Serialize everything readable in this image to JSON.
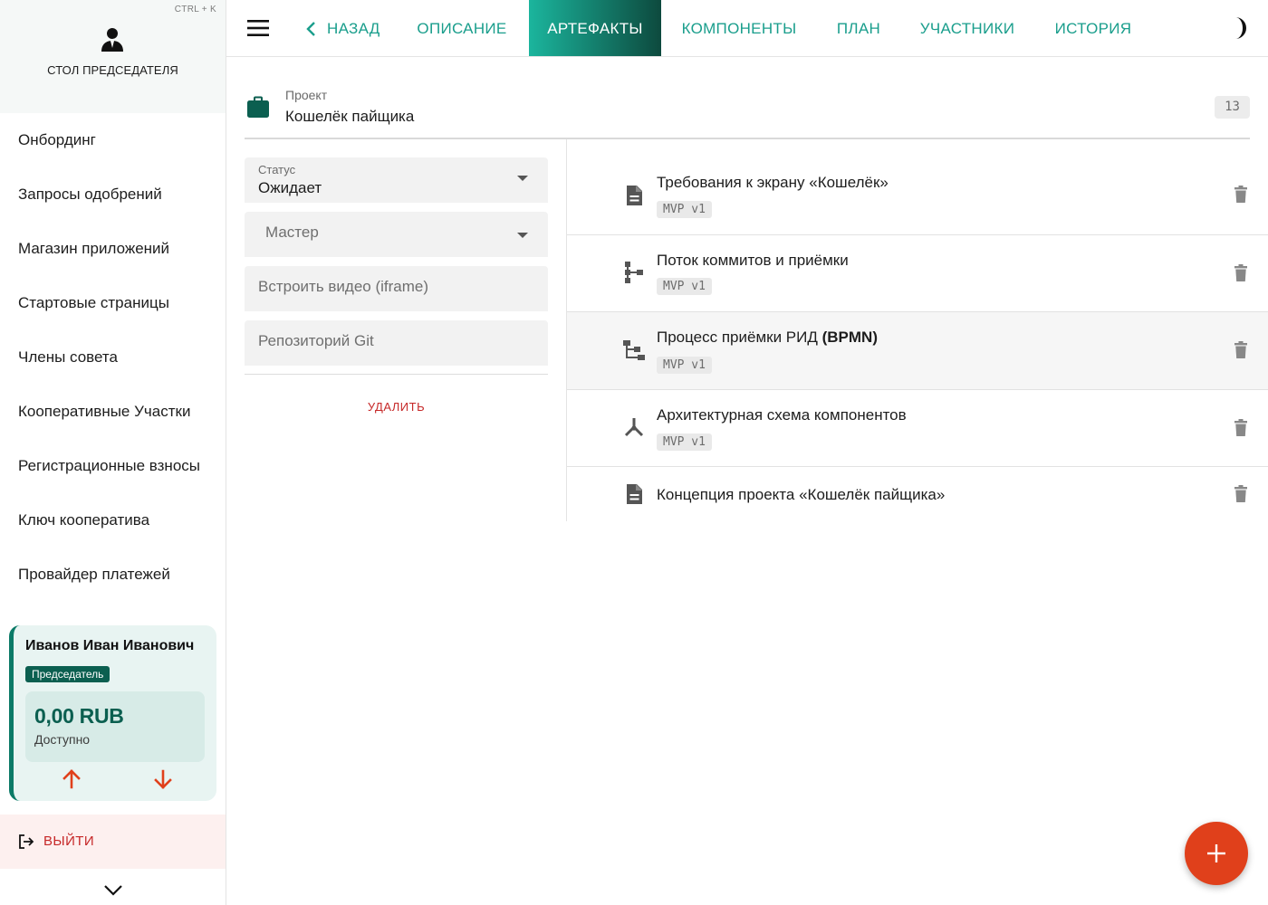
{
  "sidebar": {
    "shortcut": "CTRL + K",
    "title": "СТОЛ ПРЕДСЕДАТЕЛЯ",
    "menu": [
      {
        "label": "Онбординг"
      },
      {
        "label": "Запросы одобрений"
      },
      {
        "label": "Магазин приложений"
      },
      {
        "label": "Стартовые страницы"
      },
      {
        "label": "Члены совета"
      },
      {
        "label": "Кооперативные Участки"
      },
      {
        "label": "Регистрационные взносы"
      },
      {
        "label": "Ключ кооператива"
      },
      {
        "label": "Провайдер платежей"
      }
    ],
    "user": {
      "name": "Иванов Иван Иванович",
      "role": "Председатель",
      "balance": "0,00 RUB",
      "balance_caption": "Доступно"
    },
    "logout_label": "ВЫЙТИ"
  },
  "topbar": {
    "back_label": "НАЗАД",
    "tabs": [
      {
        "label": "ОПИСАНИЕ",
        "active": false
      },
      {
        "label": "АРТЕФАКТЫ",
        "active": true
      },
      {
        "label": "КОМПОНЕНТЫ",
        "active": false
      },
      {
        "label": "ПЛАН",
        "active": false
      },
      {
        "label": "УЧАСТНИКИ",
        "active": false
      },
      {
        "label": "ИСТОРИЯ",
        "active": false
      }
    ]
  },
  "project": {
    "caption": "Проект",
    "name": "Кошелёк пайщика",
    "count": "13"
  },
  "form": {
    "status": {
      "label": "Статус",
      "value": "Ожидает"
    },
    "master": {
      "placeholder": "Мастер"
    },
    "video": {
      "placeholder": "Встроить видео (iframe)"
    },
    "repo": {
      "placeholder": "Репозиторий Git"
    },
    "delete_label": "УДАЛИТЬ"
  },
  "artifacts": [
    {
      "icon": "document-icon",
      "title": "Требования к экрану «Кошелёк»",
      "tag": "MVP v1"
    },
    {
      "icon": "flow-icon",
      "title": "Поток коммитов и приёмки",
      "tag": "MVP v1"
    },
    {
      "icon": "bpmn-tree-icon",
      "title": "Процесс приёмки РИД ",
      "title_bold": "(BPMN)",
      "tag": "MVP v1"
    },
    {
      "icon": "hub-icon",
      "title": "Архитектурная схема компонентов",
      "tag": "MVP v1"
    },
    {
      "icon": "document-icon",
      "title": "Концепция проекта «Кошелёк пайщика»"
    }
  ],
  "colors": {
    "accent": "#1a9e8c",
    "brand_dark": "#0b5f50",
    "danger": "#c62828",
    "fab": "#e0401b"
  }
}
